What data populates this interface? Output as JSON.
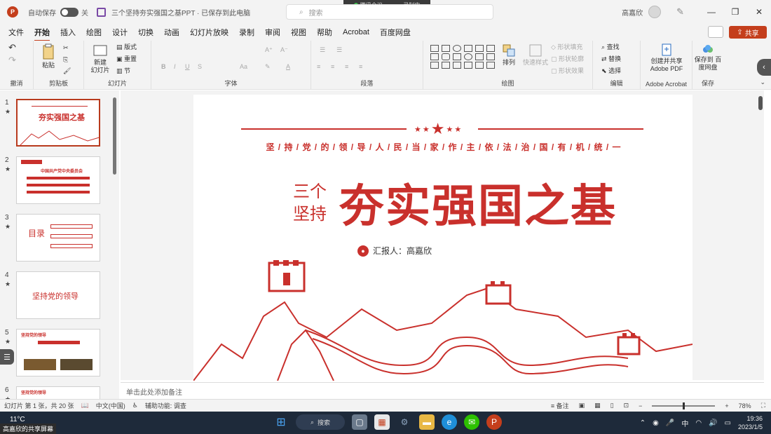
{
  "titlebar": {
    "autosave_label": "自动保存",
    "autosave_state": "关",
    "doc_title": "三个坚持夯实强国之基PPT · 已保存到此电脑",
    "search_placeholder": "搜索",
    "meeting_label": "腾讯会议",
    "recording_label": "录制中",
    "user_name": "高嘉欣"
  },
  "menu": {
    "items": [
      "文件",
      "开始",
      "插入",
      "绘图",
      "设计",
      "切换",
      "动画",
      "幻灯片放映",
      "录制",
      "审阅",
      "视图",
      "帮助",
      "Acrobat",
      "百度网盘"
    ],
    "share_label": "共享"
  },
  "ribbon": {
    "groups": {
      "undo": "撤消",
      "clipboard": "剪贴板",
      "slides": "幻灯片",
      "font": "字体",
      "paragraph": "段落",
      "drawing": "绘图",
      "editing": "编辑",
      "acrobat": "Adobe Acrobat",
      "save": "保存"
    },
    "paste": "粘贴",
    "new_slide": "新建\n幻灯片",
    "layout": "版式",
    "reset": "重置",
    "section": "节",
    "arrange": "排列",
    "quick_styles": "快速样式",
    "shape_fill": "形状填充",
    "shape_outline": "形状轮廓",
    "shape_effects": "形状效果",
    "find": "查找",
    "replace": "替换",
    "select": "选择",
    "create_pdf": "创建并共享 Adobe PDF",
    "save_baidu": "保存到 百度网盘"
  },
  "thumbnails": [
    {
      "num": "1",
      "title": "夯实强国之基"
    },
    {
      "num": "2",
      "title": "中国共产党中央委员会"
    },
    {
      "num": "3",
      "title": "目录"
    },
    {
      "num": "4",
      "title": "坚持党的领导"
    },
    {
      "num": "5",
      "title": "坚持党的领导"
    },
    {
      "num": "6",
      "title": "坚持党的领导"
    }
  ],
  "slide": {
    "slogan": "坚 / 持 / 党 / 的 / 领 / 导 / 人 / 民 / 当 / 家 / 作 / 主 / 依 / 法 / 治 / 国 / 有 / 机 / 统 / 一",
    "sub_a": "三个",
    "sub_b": "坚持",
    "main_title": "夯实强国之基",
    "reporter": "汇报人：高嘉欣"
  },
  "notes_placeholder": "单击此处添加备注",
  "status": {
    "slide_info": "幻灯片 第 1 张，共 20 张",
    "language": "中文(中国)",
    "accessibility": "辅助功能: 调查",
    "notes_btn": "备注",
    "zoom": "78%"
  },
  "taskbar": {
    "temperature": "11°C",
    "share_screen": "高嘉欣的共享屏幕",
    "search": "搜索",
    "ime": "中",
    "time": "19:36",
    "date": "2023/1/5"
  },
  "colors": {
    "accent": "#c43e1c",
    "slide_red": "#c9302c",
    "taskbar": "#1e2a3a"
  }
}
